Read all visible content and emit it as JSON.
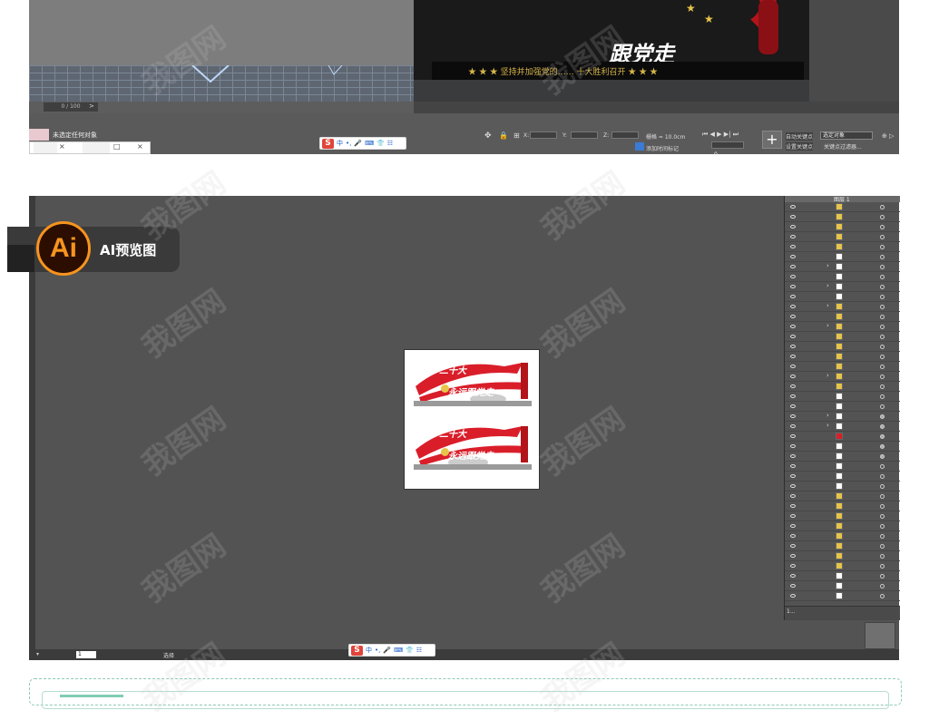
{
  "max": {
    "render": {
      "slogan_text": "★ ★ ★  坚持并加强党的…… 十大胜利召开 ★ ★ ★",
      "title": "跟党走"
    },
    "timeline": {
      "position": "0 / 100",
      "arrow": ">"
    },
    "status": {
      "selection": "未选定任何对象",
      "x_label": "X:",
      "y_label": "Y:",
      "z_label": "Z:",
      "grid_label": "栅格 = 10.0cm",
      "add_time_tag": "添加时间标记",
      "auto_key": "自动关键点",
      "set_key": "设置关键点",
      "selected_object": "选定对象",
      "key_filter": "关键点过滤器...",
      "frame": "0"
    },
    "tabs": [
      "×",
      "□",
      "×"
    ]
  },
  "sogou": {
    "logo": "S",
    "lang": "中",
    "items": [
      "•,",
      "🎤",
      "⌨",
      "👕",
      "☷"
    ]
  },
  "badge": {
    "logo": "Ai",
    "label": "AI预览图"
  },
  "canvas": {
    "banner_num": "二十大",
    "banner_slogan": "永远跟党走"
  },
  "layers": {
    "header": "图层 1",
    "footer": "1..."
  },
  "ai_bottom": {
    "zoom": "▾",
    "page": "1",
    "status": "选择"
  },
  "watermark": "我图网",
  "colors": {
    "red": "#d91e2a",
    "gold": "#e7c44a",
    "ai_orange": "#f7941e",
    "dark_panel": "#535353"
  }
}
